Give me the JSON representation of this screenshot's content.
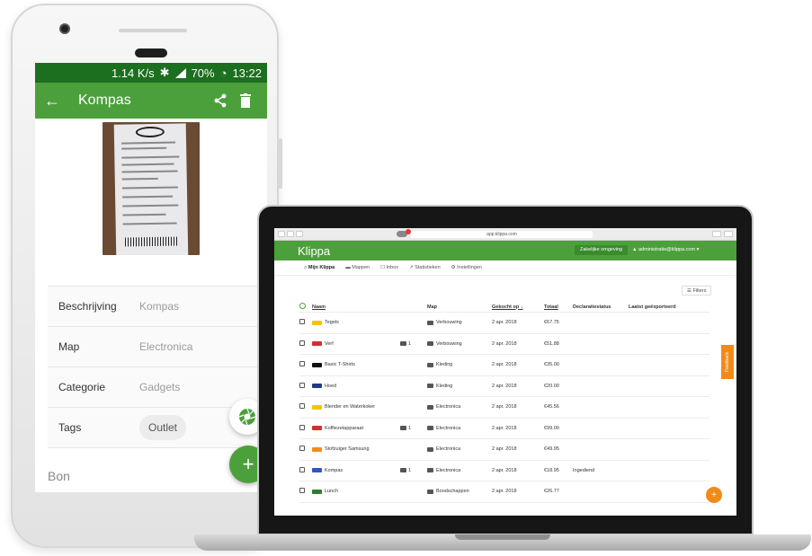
{
  "phone": {
    "status": {
      "speed": "1.14 K/s",
      "battery": "70%",
      "time": "13:22"
    },
    "app_bar": {
      "title": "Kompas"
    },
    "details": [
      {
        "label": "Beschrijving",
        "value": "Kompas"
      },
      {
        "label": "Map",
        "value": "Electronica"
      },
      {
        "label": "Categorie",
        "value": "Gadgets"
      }
    ],
    "tags": {
      "label": "Tags",
      "tag": "Outlet"
    },
    "bon_label": "Bon",
    "fab_add": "+"
  },
  "browser": {
    "url": "app.klippa.com"
  },
  "klippa": {
    "brand": "Klippa",
    "env_button": "Zakelijke omgeving",
    "account": "administratie@klippa.com",
    "nav": [
      "Mijn Klippa",
      "Mappen",
      "Inbox",
      "Statistieken",
      "Instellingen"
    ],
    "filters": "Filters",
    "feedback": "Feedback",
    "fab": "+",
    "columns": [
      "Naam",
      "Map",
      "Gekocht op",
      "Totaal",
      "Declaratiestatus",
      "Laatst geëxporteerd"
    ],
    "rows": [
      {
        "name": "Tegels",
        "attachments": "",
        "folder": "Verbouwing",
        "date": "2 apr. 2018",
        "total": "€67.75",
        "status": "",
        "logo_color": "#f5c400"
      },
      {
        "name": "Verf",
        "attachments": "1",
        "folder": "Verbouwing",
        "date": "2 apr. 2018",
        "total": "€51.88",
        "status": "",
        "logo_color": "#d32f2f"
      },
      {
        "name": "Basic T-Shirts",
        "attachments": "",
        "folder": "Kleding",
        "date": "2 apr. 2018",
        "total": "€35.00",
        "status": "",
        "logo_color": "#111111"
      },
      {
        "name": "Hoed",
        "attachments": "",
        "folder": "Kleding",
        "date": "2 apr. 2018",
        "total": "€20.00",
        "status": "",
        "logo_color": "#1e3a8a"
      },
      {
        "name": "Blender en Waterkoker",
        "attachments": "",
        "folder": "Electronica",
        "date": "2 apr. 2018",
        "total": "€45.56",
        "status": "",
        "logo_color": "#f5c400"
      },
      {
        "name": "Koffiezetapparaat",
        "attachments": "1",
        "folder": "Electronica",
        "date": "2 apr. 2018",
        "total": "€99.00",
        "status": "",
        "logo_color": "#d32f2f"
      },
      {
        "name": "Stofzuiger Samsung",
        "attachments": "",
        "folder": "Electronica",
        "date": "2 apr. 2018",
        "total": "€49.95",
        "status": "",
        "logo_color": "#f28a1a"
      },
      {
        "name": "Kompas",
        "attachments": "1",
        "folder": "Electronica",
        "date": "2 apr. 2018",
        "total": "€18.95",
        "status": "Ingediend",
        "logo_color": "#2b59c3"
      },
      {
        "name": "Lunch",
        "attachments": "",
        "folder": "Boodschappen",
        "date": "2 apr. 2018",
        "total": "€26.77",
        "status": "",
        "logo_color": "#2e7d32"
      }
    ]
  },
  "colors": {
    "green": "#4ca03b",
    "dark_green": "#1c6f1f",
    "orange": "#f28a1a"
  }
}
